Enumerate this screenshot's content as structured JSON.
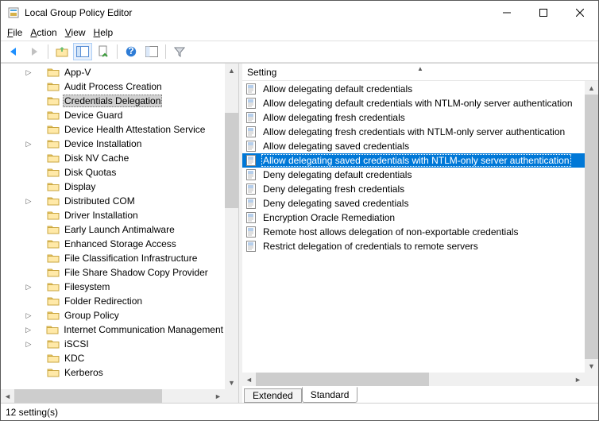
{
  "window": {
    "title": "Local Group Policy Editor"
  },
  "menu": {
    "file": "File",
    "action": "Action",
    "view": "View",
    "help": "Help"
  },
  "tree": {
    "items": [
      {
        "label": "App-V",
        "expandable": true
      },
      {
        "label": "Audit Process Creation",
        "expandable": false
      },
      {
        "label": "Credentials Delegation",
        "expandable": false,
        "selected": true
      },
      {
        "label": "Device Guard",
        "expandable": false
      },
      {
        "label": "Device Health Attestation Service",
        "expandable": false
      },
      {
        "label": "Device Installation",
        "expandable": true
      },
      {
        "label": "Disk NV Cache",
        "expandable": false
      },
      {
        "label": "Disk Quotas",
        "expandable": false
      },
      {
        "label": "Display",
        "expandable": false
      },
      {
        "label": "Distributed COM",
        "expandable": true
      },
      {
        "label": "Driver Installation",
        "expandable": false
      },
      {
        "label": "Early Launch Antimalware",
        "expandable": false
      },
      {
        "label": "Enhanced Storage Access",
        "expandable": false
      },
      {
        "label": "File Classification Infrastructure",
        "expandable": false
      },
      {
        "label": "File Share Shadow Copy Provider",
        "expandable": false
      },
      {
        "label": "Filesystem",
        "expandable": true
      },
      {
        "label": "Folder Redirection",
        "expandable": false
      },
      {
        "label": "Group Policy",
        "expandable": true
      },
      {
        "label": "Internet Communication Management",
        "expandable": true
      },
      {
        "label": "iSCSI",
        "expandable": true
      },
      {
        "label": "KDC",
        "expandable": false
      },
      {
        "label": "Kerberos",
        "expandable": false
      }
    ]
  },
  "list": {
    "header": "Setting",
    "items": [
      {
        "label": "Allow delegating default credentials"
      },
      {
        "label": "Allow delegating default credentials with NTLM-only server authentication"
      },
      {
        "label": "Allow delegating fresh credentials"
      },
      {
        "label": "Allow delegating fresh credentials with NTLM-only server authentication"
      },
      {
        "label": "Allow delegating saved credentials"
      },
      {
        "label": "Allow delegating saved credentials with NTLM-only server authentication",
        "selected": true
      },
      {
        "label": "Deny delegating default credentials"
      },
      {
        "label": "Deny delegating fresh credentials"
      },
      {
        "label": "Deny delegating saved credentials"
      },
      {
        "label": "Encryption Oracle Remediation"
      },
      {
        "label": "Remote host allows delegation of non-exportable credentials"
      },
      {
        "label": "Restrict delegation of credentials to remote servers"
      }
    ]
  },
  "tabs": {
    "extended": "Extended",
    "standard": "Standard"
  },
  "status": "12 setting(s)"
}
